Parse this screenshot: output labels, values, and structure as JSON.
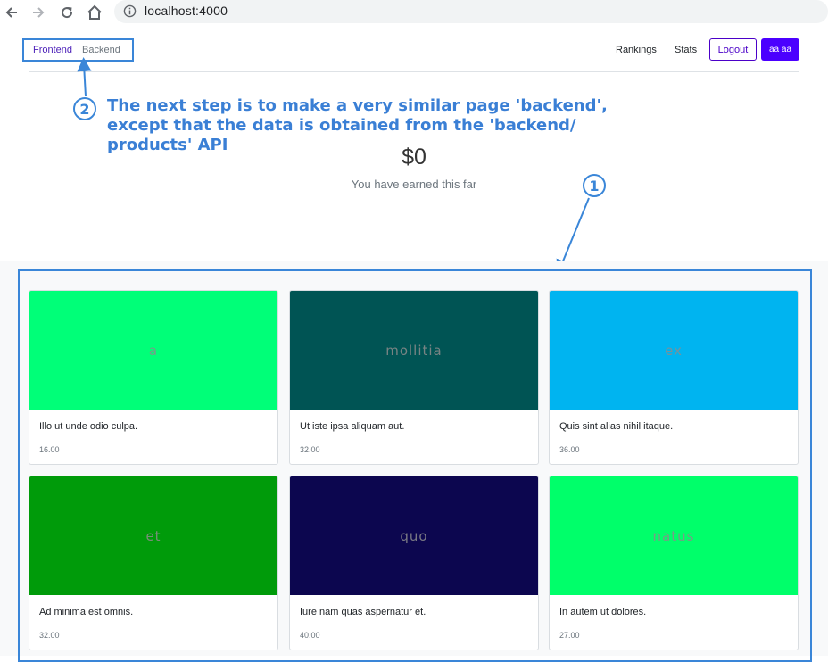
{
  "browser": {
    "url": "localhost:4000"
  },
  "nav": {
    "tabs": [
      "Frontend",
      "Backend"
    ],
    "links": [
      "Rankings",
      "Stats"
    ],
    "logout_label": "Logout",
    "user_label": "aa aa"
  },
  "annotations": {
    "step1_number": "1",
    "step2_number": "2",
    "step2_text": "The next step is to make a very similar page 'backend', except that the data is obtained from the 'backend/ products' API"
  },
  "earnings": {
    "amount": "$0",
    "label": "You have earned this far"
  },
  "products": [
    {
      "image_text": "a",
      "title": "Illo ut unde odio culpa.",
      "price": "16.00",
      "color": "#00ff78"
    },
    {
      "image_text": "mollitia",
      "title": "Ut iste ipsa aliquam aut.",
      "price": "32.00",
      "color": "#005454"
    },
    {
      "image_text": "ex",
      "title": "Quis sint alias nihil itaque.",
      "price": "36.00",
      "color": "#00b4f0"
    },
    {
      "image_text": "et",
      "title": "Ad minima est omnis.",
      "price": "32.00",
      "color": "#009b0a"
    },
    {
      "image_text": "quo",
      "title": "Iure nam quas aspernatur et.",
      "price": "40.00",
      "color": "#0c064f"
    },
    {
      "image_text": "natus",
      "title": "In autem ut dolores.",
      "price": "27.00",
      "color": "#00ff6a"
    }
  ],
  "colors": {
    "accent": "#4b00ff",
    "annotation": "#3a86d8"
  }
}
